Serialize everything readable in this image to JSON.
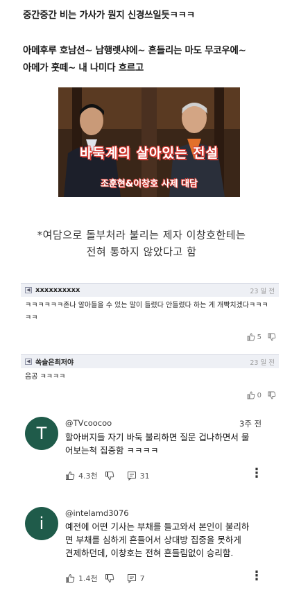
{
  "post": {
    "line1": "중간중간 비는 가사가 뭔지 신경쓰일듯ㅋㅋㅋ",
    "line2": "아메후루 호남선~ 남행렛샤에~ 흔들리는 마도 무코우에~",
    "line3": "아메가 훗떼~ 내 나미다 흐르고"
  },
  "image": {
    "title": "바둑계의 살아있는 전설",
    "subtitle": "조훈현&이창호 사제 대담"
  },
  "caption": {
    "line1": "*여담으로 돌부처라 불리는 제자 이창호한테는",
    "line2": "전혀 통하지 않았다고 함"
  },
  "dc_comments": [
    {
      "author": "xxxxxxxxxx",
      "date": "23 일 전",
      "text": "ㅋㅋㅋㅋㅋㅋ존나 알아들을 수 있는 말이 들렸다 안들렸다 하는 게 개빡치겠다ㅋㅋㅋㅋㅋ",
      "likes": "5"
    },
    {
      "author": "쏙슬은최저야",
      "date": "23 일 전",
      "text": "음공 ㅋㅋㅋㅋ",
      "likes": "0"
    }
  ],
  "yt_comments": [
    {
      "avatar_letter": "T",
      "avatar_color": "#1f5b4a",
      "handle": "@TVcoocoo",
      "time": "3주 전",
      "text_lines": [
        "할아버지들 자기 바둑 불리하면 질문 겁나하면서 물",
        "어보는척 집중함 ㅋㅋㅋㅋ"
      ],
      "likes": "4.3천",
      "replies": "31"
    },
    {
      "avatar_letter": "i",
      "avatar_color": "#1f5b4a",
      "handle": "@intelamd3076",
      "time": "",
      "text_lines": [
        "예전에 어떤 기사는 부채를 들고와서 본인이 불리하",
        "면 부채를 심하게 흔들어서 상대방 집중을 못하게",
        "견제하던데, 이창호는 전혀 흔들림없이  승리함."
      ],
      "likes": "1.4천",
      "replies": "7"
    }
  ]
}
